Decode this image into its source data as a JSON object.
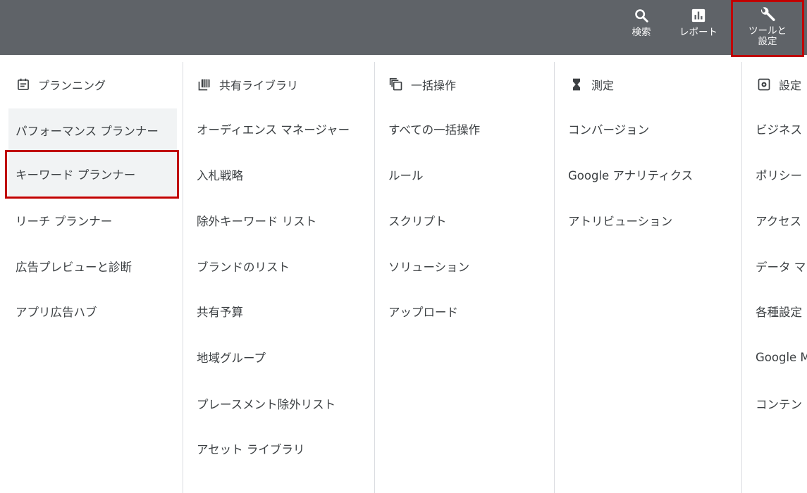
{
  "topbar": {
    "search": {
      "label": "検索",
      "icon": "search-icon"
    },
    "report": {
      "label": "レポート",
      "icon": "report-icon"
    },
    "tools": {
      "label": "ツールと\n設定",
      "icon": "wrench-icon"
    }
  },
  "colors": {
    "topbar": "#5f6368",
    "highlight": "#c00000",
    "active_row": "#f1f3f4"
  },
  "columns": [
    {
      "title": "プランニング",
      "icon": "calendar-icon",
      "items": [
        "パフォーマンス プランナー",
        "キーワード プランナー",
        "リーチ プランナー",
        "広告プレビューと診断",
        "アプリ広告ハブ"
      ]
    },
    {
      "title": "共有ライブラリ",
      "icon": "library-icon",
      "items": [
        "オーディエンス マネージャー",
        "入札戦略",
        "除外キーワード リスト",
        "ブランドのリスト",
        "共有予算",
        "地域グループ",
        "プレースメント除外リスト",
        "アセット ライブラリ"
      ]
    },
    {
      "title": "一括操作",
      "icon": "bulk-copy-icon",
      "items": [
        "すべての一括操作",
        "ルール",
        "スクリプト",
        "ソリューション",
        "アップロード"
      ]
    },
    {
      "title": "測定",
      "icon": "hourglass-icon",
      "items": [
        "コンバージョン",
        "Google アナリティクス",
        "アトリビューション"
      ]
    },
    {
      "title": "設定",
      "icon": "settings-icon",
      "items": [
        "ビジネス",
        "ポリシー",
        "アクセス",
        "データ マ",
        "各種設定",
        "Google M",
        "コンテン"
      ]
    }
  ]
}
